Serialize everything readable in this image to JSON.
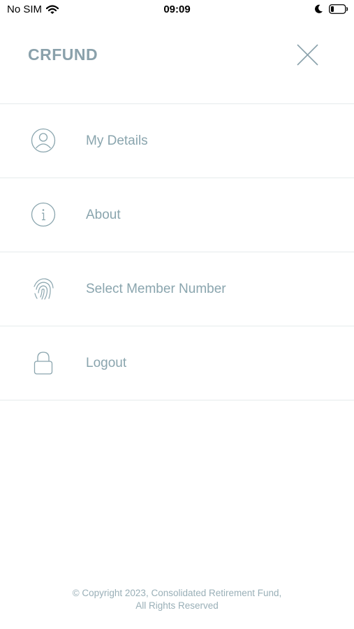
{
  "status_bar": {
    "carrier": "No SIM",
    "time": "09:09",
    "icons": [
      "wifi-icon",
      "moon-icon",
      "battery-icon"
    ]
  },
  "header": {
    "brand": "CRFUND",
    "close_icon": "close-icon"
  },
  "menu": {
    "items": [
      {
        "label": "My Details",
        "icon": "user-icon"
      },
      {
        "label": "About",
        "icon": "info-icon"
      },
      {
        "label": "Select Member Number",
        "icon": "fingerprint-icon"
      },
      {
        "label": "Logout",
        "icon": "lock-icon"
      }
    ]
  },
  "footer": {
    "line1": "© Copyright 2023, Consolidated Retirement Fund,",
    "line2": "All Rights Reserved"
  },
  "colors": {
    "accent": "#8aa5ae",
    "divider": "#e6ebec"
  }
}
